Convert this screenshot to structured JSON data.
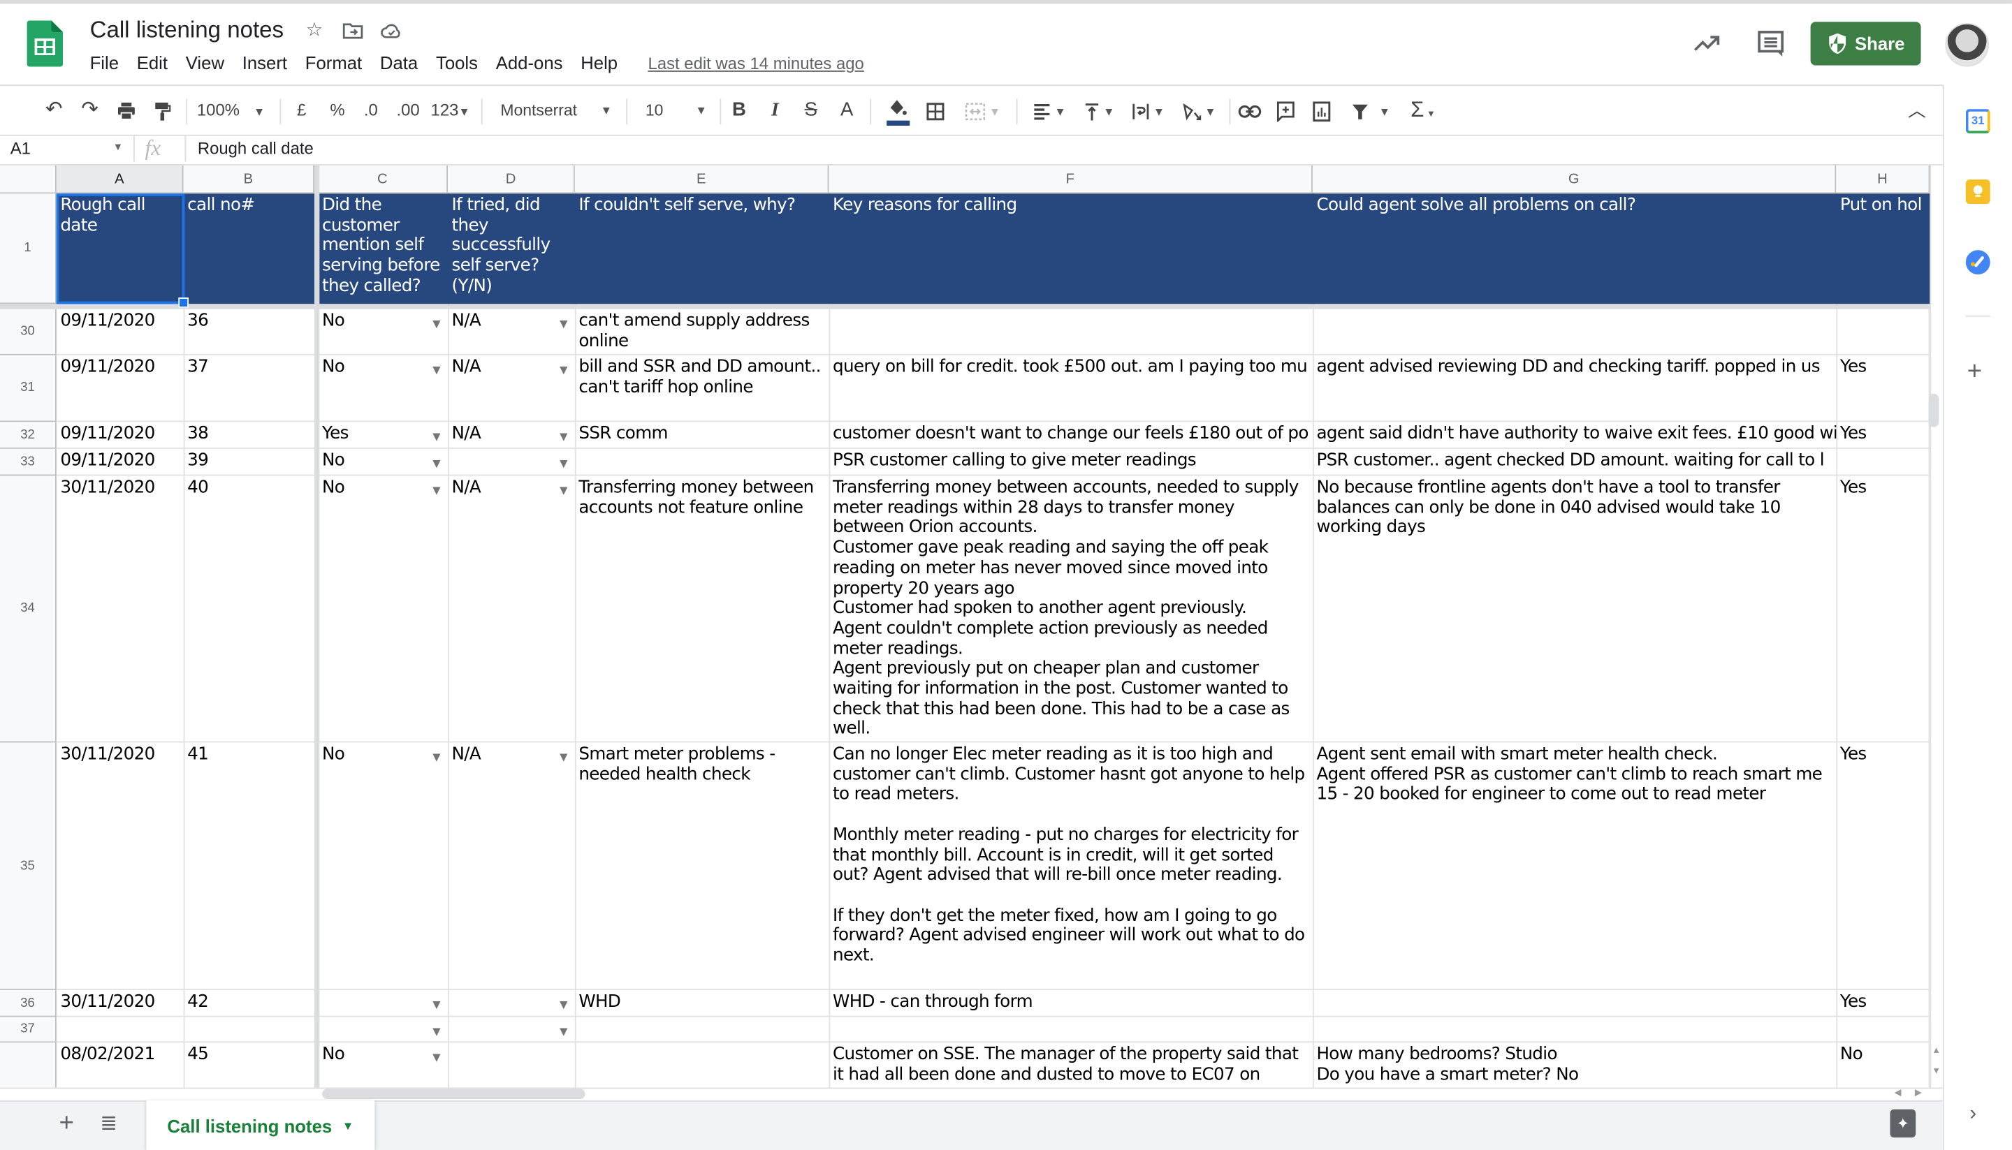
{
  "app": {
    "title": "Call listening notes",
    "menus": [
      "File",
      "Edit",
      "View",
      "Insert",
      "Format",
      "Data",
      "Tools",
      "Add-ons",
      "Help"
    ],
    "last_edit": "Last edit was 14 minutes ago",
    "share_label": "Share",
    "brand_color": "#3c7e44",
    "header_fill_color": "#27477f"
  },
  "toolbar": {
    "zoom": "100%",
    "currency": "£",
    "percent": "%",
    "decrease_decimals": ".0",
    "increase_decimals": ".00",
    "more_formats": "123",
    "font": "Montserrat",
    "font_size": "10",
    "bold": "B",
    "italic": "I",
    "strikethrough": "S",
    "text_color": "A",
    "functions": "Σ"
  },
  "formula_bar": {
    "name_box": "A1",
    "fx": "fx",
    "content": "Rough call date"
  },
  "grid": {
    "columns": [
      "A",
      "B",
      "C",
      "D",
      "E",
      "F",
      "G",
      "H"
    ],
    "header_row": {
      "row_number": "1",
      "cells": [
        "Rough call date",
        "call no#",
        "Did the customer mention self serving before they called?",
        "If tried, did they successfully self serve? (Y/N)",
        "If couldn't self serve, why?",
        "Key reasons for calling",
        "Could agent solve all problems on call?",
        "Put on hol"
      ]
    },
    "rows": [
      {
        "row_number": "30",
        "date": "09/11/2020",
        "call_no": "36",
        "mentioned_self_serve": "No",
        "self_served": "N/A",
        "why": "can't amend supply address online",
        "reasons": "",
        "solved": "",
        "on_hold": ""
      },
      {
        "row_number": "31",
        "date": "09/11/2020",
        "call_no": "37",
        "mentioned_self_serve": "No",
        "self_served": "N/A",
        "why": "bill and SSR and DD amount.. can't tariff hop online",
        "reasons": "query on bill for credit. took £500 out. am I paying too mu",
        "solved": "agent advised reviewing DD and checking tariff. popped in us",
        "on_hold": "Yes"
      },
      {
        "row_number": "32",
        "date": "09/11/2020",
        "call_no": "38",
        "mentioned_self_serve": "Yes",
        "self_served": "N/A",
        "why": "SSR comm",
        "reasons": "customer doesn't want to change our feels £180 out of po",
        "solved": "agent said didn't have authority to waive exit fees. £10 good wi",
        "on_hold": "Yes"
      },
      {
        "row_number": "33",
        "date": "09/11/2020",
        "call_no": "39",
        "mentioned_self_serve": "No",
        "self_served": "",
        "why": "",
        "reasons": "PSR customer calling to give meter readings",
        "solved": "PSR customer.. agent checked DD amount. waiting for call to l",
        "on_hold": ""
      },
      {
        "row_number": "34",
        "date": "30/11/2020",
        "call_no": "40",
        "mentioned_self_serve": "No",
        "self_served": "N/A",
        "why": "Transferring money between accounts not feature online",
        "reasons": "Transferring money between accounts, needed to supply meter readings within 28 days to transfer money between Orion accounts.\nCustomer gave peak reading and saying the off peak reading on meter has never moved since moved into property 20 years ago\nCustomer had spoken to another agent previously.\nAgent couldn't complete action previously as needed meter readings.\nAgent previously put on cheaper plan and customer waiting for information in the post. Customer wanted to check that this had been done. This had to be a case as well.",
        "solved": "No because frontline agents don't have a tool to transfer balances can only be done in 040 advised would take 10 working days",
        "on_hold": "Yes"
      },
      {
        "row_number": "35",
        "date": "30/11/2020",
        "call_no": "41",
        "mentioned_self_serve": "No",
        "self_served": "N/A",
        "why": "Smart meter problems - needed health check",
        "reasons": "Can no longer Elec meter reading as it is too high and customer can't climb. Customer hasnt got anyone to help to read meters.\n\nMonthly meter reading - put no charges for electricity for that monthly bill. Account is in credit, will it get sorted out? Agent advised that will re-bill once meter reading.\n\nIf they don't get the meter fixed, how am I going to go forward? Agent advised engineer will work out what to do next.",
        "solved": "Agent sent email with smart meter health check.\nAgent offered PSR as customer can't climb to reach smart me\n15 - 20 booked for engineer to come out to read meter",
        "on_hold": "Yes"
      },
      {
        "row_number": "36",
        "date": "30/11/2020",
        "call_no": "42",
        "mentioned_self_serve": "",
        "self_served": "",
        "why": "WHD",
        "reasons": "WHD - can through form",
        "solved": "",
        "on_hold": "Yes"
      },
      {
        "row_number": "37",
        "date": "",
        "call_no": "",
        "mentioned_self_serve": "",
        "self_served": "",
        "why": "",
        "reasons": "",
        "solved": "",
        "on_hold": ""
      },
      {
        "row_number": "",
        "date": "08/02/2021",
        "call_no": "45",
        "mentioned_self_serve": "No",
        "self_served": "",
        "why": "",
        "reasons": "Customer on SSE. The manager of the property said that it had all been done and dusted to move to EC07 on",
        "solved": "How many bedrooms? Studio\nDo you have a smart meter? No",
        "on_hold": "No"
      }
    ]
  },
  "sheets": {
    "tabs": [
      {
        "label": "Call listening notes",
        "active": true
      }
    ]
  },
  "side_panel": {
    "apps": [
      "calendar",
      "keep",
      "tasks"
    ],
    "calendar_day": "31"
  }
}
